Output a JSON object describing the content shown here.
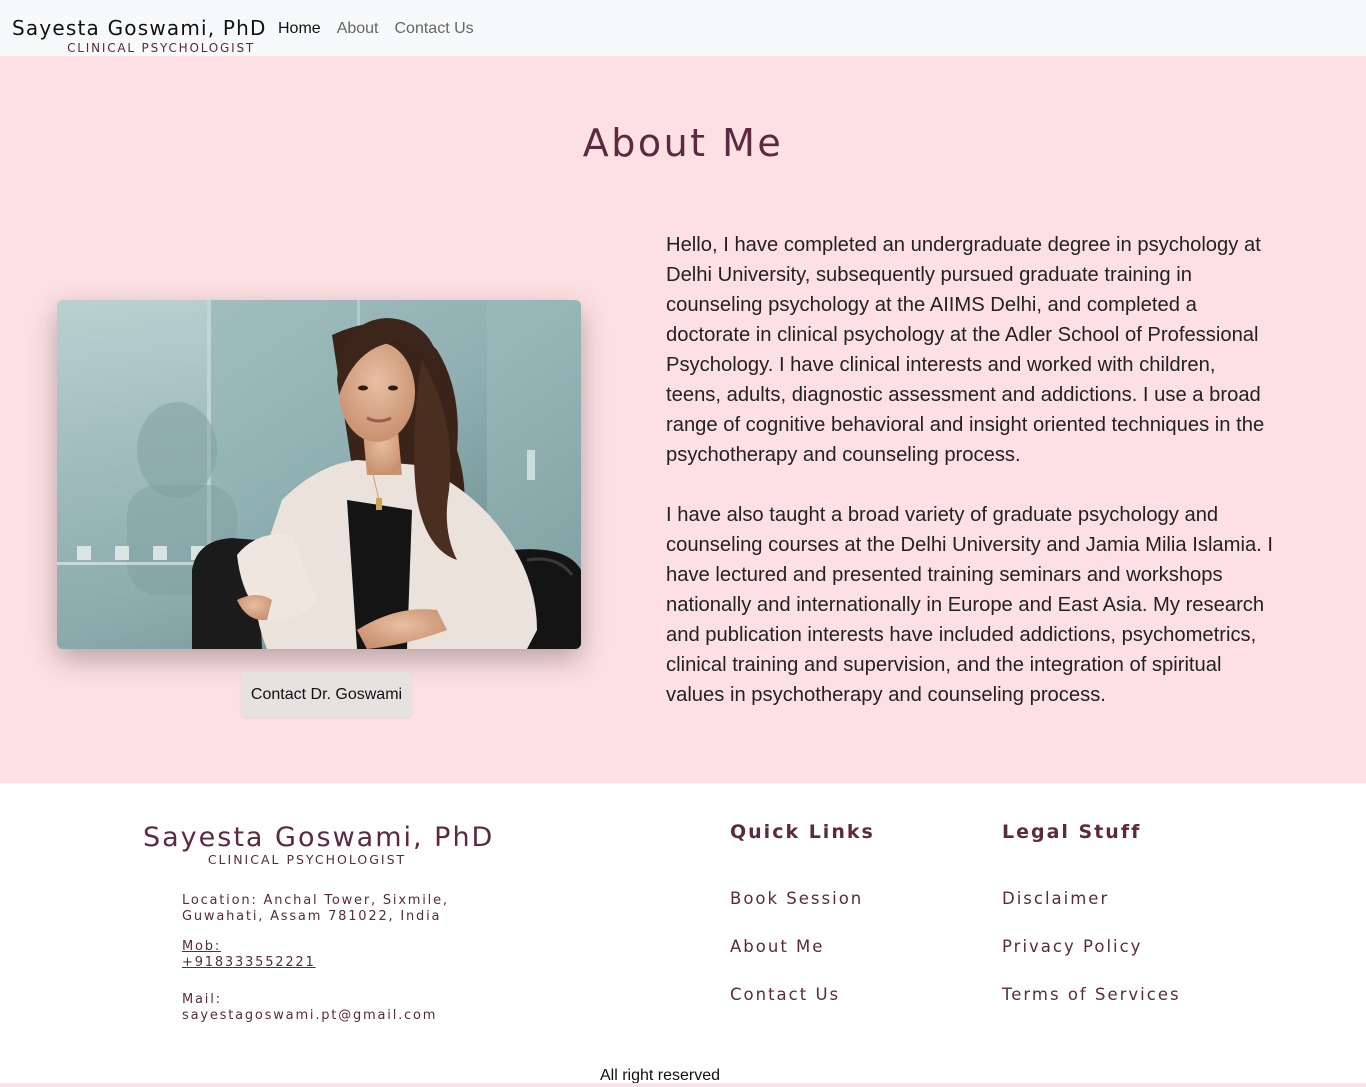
{
  "nav": {
    "brand_name": "Sayesta Goswami, PhD",
    "brand_sub": "CLINICAL PSYCHOLOGIST",
    "links": [
      {
        "label": "Home",
        "active": true
      },
      {
        "label": "About",
        "active": false
      },
      {
        "label": "Contact Us",
        "active": false
      }
    ]
  },
  "about": {
    "title": "About Me",
    "photo_alt": "Portrait of Dr. Sayesta Goswami",
    "contact_button": "Contact Dr. Goswami",
    "paragraphs": [
      "Hello, I have completed an undergraduate degree in psychology at Delhi University, subsequently pursued graduate training in counseling psychology at the AIIMS Delhi, and completed a doctorate in clinical psychology at the Adler School of Professional Psychology. I have clinical interests and worked with children, teens, adults, diagnostic assessment and addictions. I use a broad range of cognitive behavioral and insight oriented techniques in the psychotherapy and counseling process.",
      "I have also taught a broad variety of graduate psychology and counseling courses at the Delhi University and Jamia Milia Islamia. I have lectured and presented training seminars and workshops nationally and internationally in Europe and East Asia. My research and publication interests have included addictions, psychometrics, clinical training and supervision, and the integration of spiritual values in psychotherapy and counseling process."
    ]
  },
  "footer": {
    "brand_name": "Sayesta Goswami, PhD",
    "brand_sub": "CLINICAL PSYCHOLOGIST",
    "location_line1": "Location: Anchal Tower, Sixmile,",
    "location_line2": "Guwahati, Assam 781022, India",
    "mob_label": "Mob:",
    "mob_number": "+918333552221",
    "mail_label": "Mail:",
    "mail_address": "sayestagoswami.pt@gmail.com",
    "quick_links": {
      "heading": "Quick Links",
      "items": [
        "Book Session",
        "About Me",
        "Contact Us"
      ]
    },
    "legal": {
      "heading": "Legal Stuff",
      "items": [
        "Disclaimer",
        "Privacy Policy",
        "Terms of Services"
      ]
    },
    "copyright": "All right reserved"
  },
  "colors": {
    "accent": "#5c2940",
    "section_bg": "#fde0e3",
    "navbar_bg": "#f8f9fa"
  }
}
